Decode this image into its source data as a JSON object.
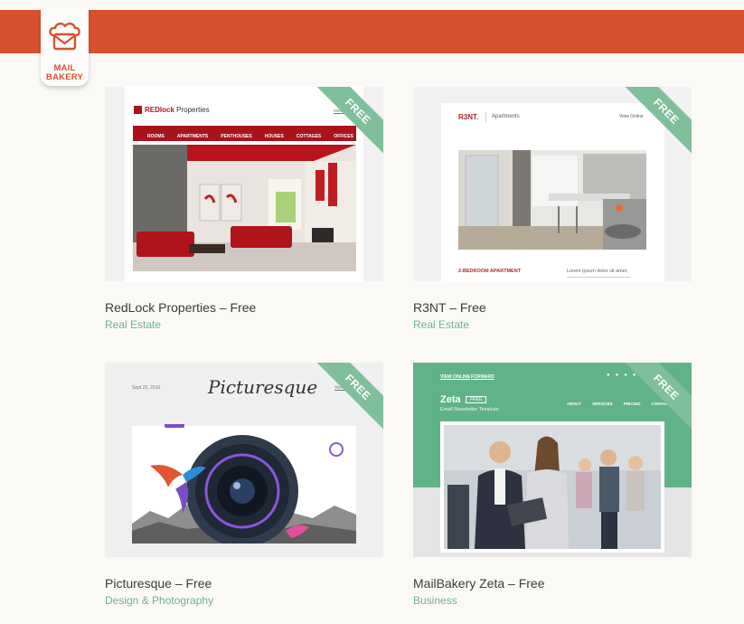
{
  "brand": {
    "logo_line1": "MAIL",
    "logo_line2": "BAKERY",
    "logo_icon": "envelope-chef-hat-icon",
    "accent": "#d9502e"
  },
  "ribbon_color": "#7fbf9b",
  "cards": [
    {
      "title": "RedLock Properties – Free",
      "category": "Real Estate",
      "badge": "FREE",
      "preview": {
        "logo_bold": "REDlock",
        "logo_rest": " Properties",
        "view_link": "view online",
        "nav": [
          "ROOMS",
          "APARTMENTS",
          "PENTHOUSES",
          "HOUSES",
          "COTTAGES",
          "OFFICES"
        ]
      }
    },
    {
      "title": "R3NT – Free",
      "category": "Real Estate",
      "badge": "FREE",
      "preview": {
        "logo": "R3NT.",
        "section": "Apartments",
        "view_link": "View Online",
        "heading": "2-BEDROOM APARTMENT",
        "body": "Lorem ipsum dolor sit amet,"
      }
    },
    {
      "title": "Picturesque – Free",
      "category": "Design & Photography",
      "badge": "FREE",
      "preview": {
        "date": "Sept 25, 2016",
        "logo": "Picturesque",
        "view_link": "View online"
      }
    },
    {
      "title": "MailBakery Zeta – Free",
      "category": "Business",
      "badge": "FREE",
      "preview": {
        "top_links": [
          "VIEW ONLINE",
          "FORWARD"
        ],
        "logo": "Zeta",
        "logo_badge": "FREE",
        "subtitle": "Email Newsletter Template",
        "nav": [
          "ABOUT",
          "SERVICES",
          "PRICING",
          "CONTACT"
        ]
      }
    }
  ]
}
